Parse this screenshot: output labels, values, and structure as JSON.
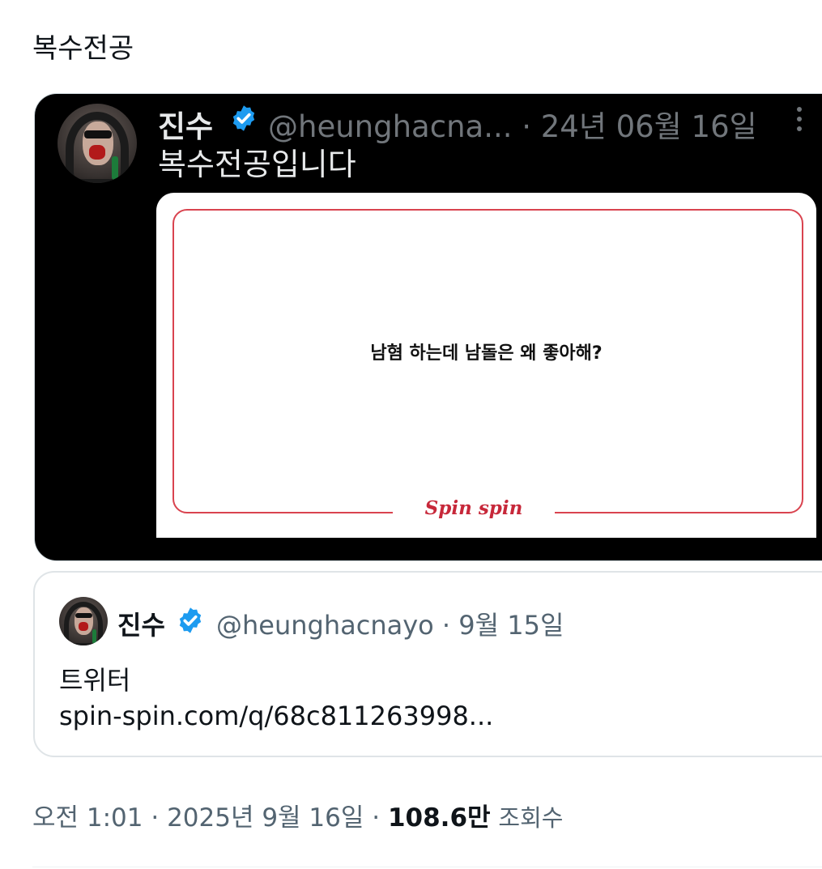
{
  "tweet": {
    "text": "복수전공"
  },
  "media": {
    "author_name": "진수",
    "author_handle_time": "@heunghacna... · 24년 06월 16일",
    "text": "복수전공입니다",
    "card": {
      "question": "남혐 하는데 남돌은 왜 좋아해?",
      "logo": "Spin spin",
      "frame_color": "#d9434f",
      "logo_color": "#c7283a"
    }
  },
  "quote": {
    "author_name": "진수",
    "author_handle_time": "@heunghacnayo · 9월 15일",
    "line1": "트위터",
    "line2": "spin-spin.com/q/68c811263998..."
  },
  "meta": {
    "time_date": "오전 1:01 · 2025년 9월 16일 · ",
    "views_count": "108.6만",
    "views_label": "조회수"
  },
  "icons": {
    "verified": "verified-badge-icon",
    "more": "more-dots-icon"
  },
  "colors": {
    "verified_blue": "#1d9bf0",
    "muted_text": "#536471",
    "text": "#0f1419"
  }
}
